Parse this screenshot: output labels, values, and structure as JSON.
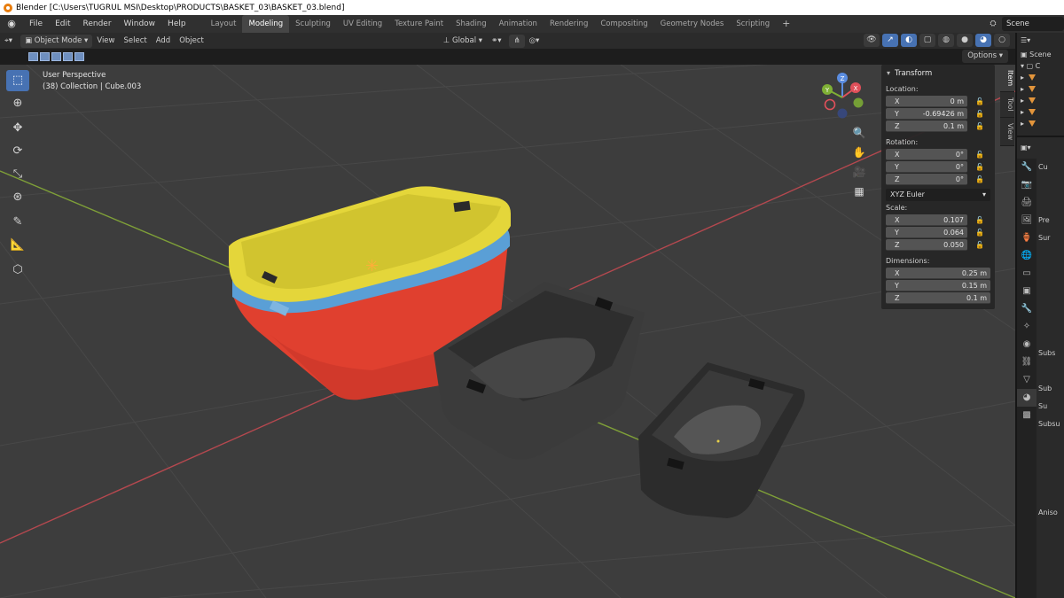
{
  "window_title": "Blender [C:\\Users\\TUGRUL MSI\\Desktop\\PRODUCTS\\BASKET_03\\BASKET_03.blend]",
  "menu": [
    "File",
    "Edit",
    "Render",
    "Window",
    "Help"
  ],
  "workspaces": [
    "Layout",
    "Modeling",
    "Sculpting",
    "UV Editing",
    "Texture Paint",
    "Shading",
    "Animation",
    "Rendering",
    "Compositing",
    "Geometry Nodes",
    "Scripting"
  ],
  "active_workspace": "Modeling",
  "scene_name": "Scene",
  "viewport_header": {
    "mode": "Object Mode",
    "menus": [
      "View",
      "Select",
      "Add",
      "Object"
    ],
    "orientation": "Global",
    "options_label": "Options"
  },
  "viewport_info": {
    "perspective": "User Perspective",
    "collection": "(38) Collection | Cube.003"
  },
  "gizmo_axes": {
    "x": "X",
    "y": "Y",
    "z": "Z"
  },
  "n_panel": {
    "title": "Transform",
    "location_label": "Location:",
    "location": [
      {
        "axis": "X",
        "value": "0 m"
      },
      {
        "axis": "Y",
        "value": "-0.69426 m"
      },
      {
        "axis": "Z",
        "value": "0.1 m"
      }
    ],
    "rotation_label": "Rotation:",
    "rotation": [
      {
        "axis": "X",
        "value": "0°"
      },
      {
        "axis": "Y",
        "value": "0°"
      },
      {
        "axis": "Z",
        "value": "0°"
      }
    ],
    "rotation_mode": "XYZ Euler",
    "scale_label": "Scale:",
    "scale": [
      {
        "axis": "X",
        "value": "0.107"
      },
      {
        "axis": "Y",
        "value": "0.064"
      },
      {
        "axis": "Z",
        "value": "0.050"
      }
    ],
    "dimensions_label": "Dimensions:",
    "dimensions": [
      {
        "axis": "X",
        "value": "0.25 m"
      },
      {
        "axis": "Y",
        "value": "0.15 m"
      },
      {
        "axis": "Z",
        "value": "0.1 m"
      }
    ]
  },
  "n_tabs": [
    "Item",
    "Tool",
    "View"
  ],
  "outliner": {
    "scene_label": "Scene",
    "collection_label": "C"
  },
  "properties_partial": {
    "object_label": "Cu",
    "lines": [
      "Pre",
      "Sur",
      "Subs",
      "Sub",
      "Su",
      "Subsu",
      "Aniso"
    ]
  },
  "colors": {
    "accent": "#4772b3",
    "basket_yellow": "#e4d63a",
    "basket_blue": "#5a9fd6",
    "basket_red": "#e0402f",
    "basket_dark": "#3b3b3b",
    "grid_x_axis": "#b5484f",
    "grid_y_axis": "#7fa038"
  }
}
